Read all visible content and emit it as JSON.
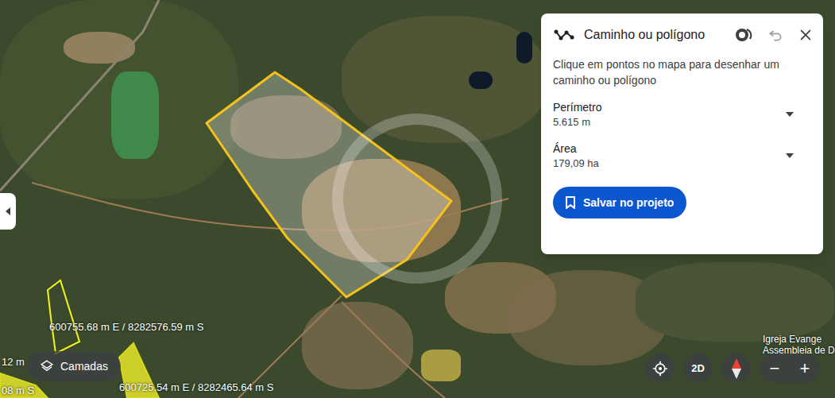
{
  "map": {
    "coordinate_labels": [
      "600755.68 m E / 8282576.59 m S",
      "600725.54 m E / 8282465.64 m S",
      "12 m",
      "08 m S"
    ],
    "place_label": [
      "Igreja Evange",
      "Assembleia de D"
    ]
  },
  "panel": {
    "title": "Caminho ou polígono",
    "instructions": "Clique em pontos no mapa para desenhar um caminho ou polígono",
    "measurements": [
      {
        "label": "Perímetro",
        "value": "5.615 m"
      },
      {
        "label": "Área",
        "value": "179,09 ha"
      }
    ],
    "save_button": "Salvar no projeto"
  },
  "controls": {
    "layers_button": "Camadas",
    "view_mode": "2D",
    "zoom_out": "−",
    "zoom_in": "+"
  }
}
